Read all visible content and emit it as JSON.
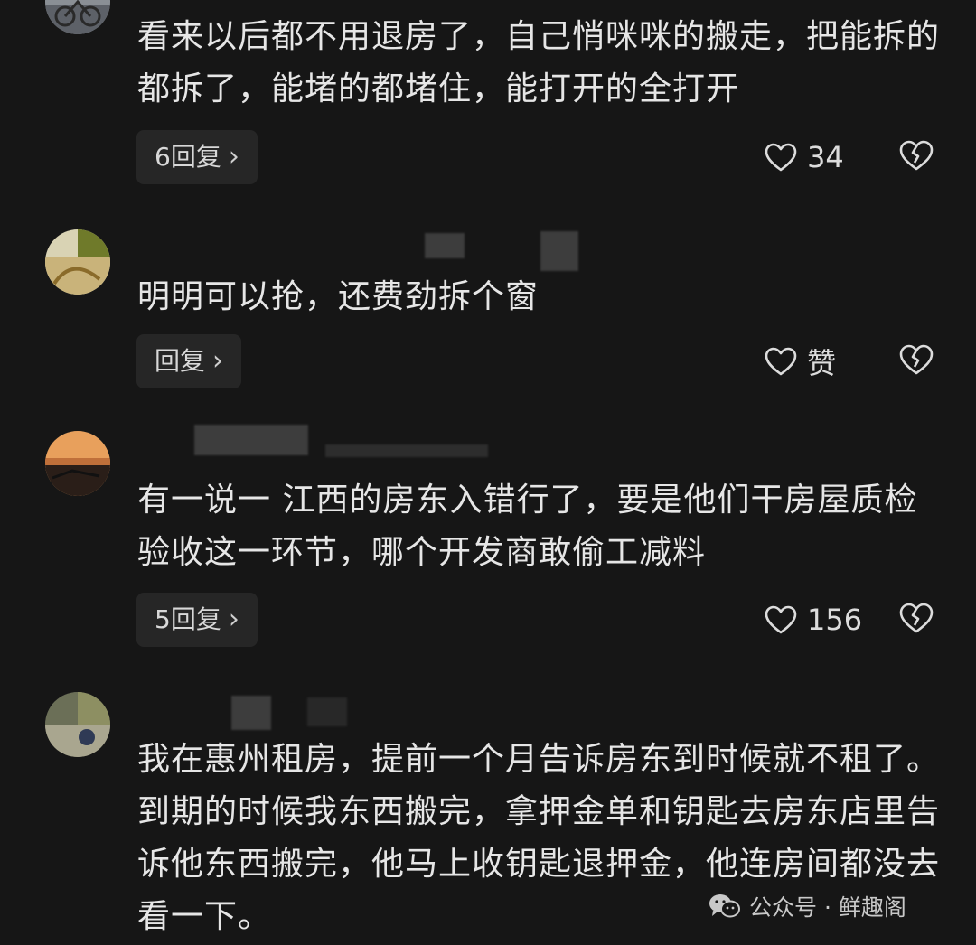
{
  "comments": [
    {
      "text": "看来以后都不用退房了，自己悄咪咪的搬走，把能拆的都拆了，能堵的都堵住，能打开的全打开",
      "reply_label": "6回复",
      "like_label": "34"
    },
    {
      "text": "明明可以抢，还费劲拆个窗",
      "reply_label": "回复",
      "like_label": "赞"
    },
    {
      "text": "有一说一 江西的房东入错行了，要是他们干房屋质检验收这一环节，哪个开发商敢偷工减料",
      "reply_label": "5回复",
      "like_label": "156"
    },
    {
      "text": "我在惠州租房，提前一个月告诉房东到时候就不租了。到期的时候我东西搬完，拿押金单和钥匙去房东店里告诉他东西搬完，他马上收钥匙退押金，他连房间都没去看一下。"
    }
  ],
  "watermark": {
    "text": "公众号 · 鲜趣阁",
    "icon": "wechat-icon"
  },
  "colors": {
    "background": "#161616",
    "text": "#e6e6e6",
    "button_bg": "#262626"
  }
}
